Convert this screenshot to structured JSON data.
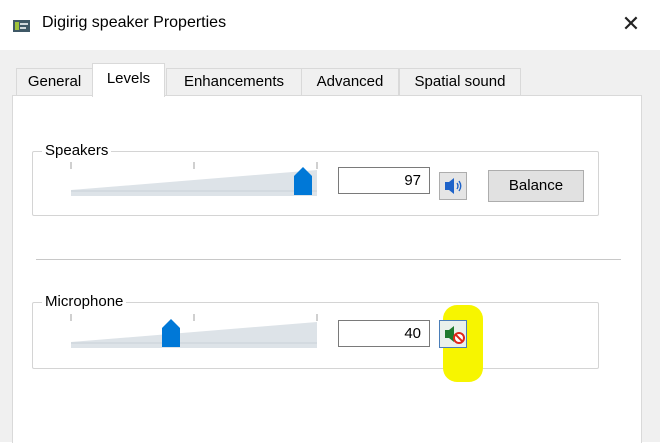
{
  "window": {
    "title": "Digirig speaker Properties",
    "close_glyph": "✕",
    "app_icon": "speaker-device-icon"
  },
  "tabs": [
    {
      "label": "General",
      "active": false
    },
    {
      "label": "Levels",
      "active": true
    },
    {
      "label": "Enhancements",
      "active": false
    },
    {
      "label": "Advanced",
      "active": false
    },
    {
      "label": "Spatial sound",
      "active": false
    }
  ],
  "speakers": {
    "label": "Speakers",
    "level": 97,
    "value_text": "97",
    "mute_icon": "speaker-volume-icon",
    "balance_label": "Balance"
  },
  "microphone": {
    "label": "Microphone",
    "level": 40,
    "value_text": "40",
    "mute_icon": "speaker-muted-icon"
  },
  "colors": {
    "accent": "#0078d7",
    "highlight": "#f7f500",
    "slider_fill": "#dde3e8"
  }
}
